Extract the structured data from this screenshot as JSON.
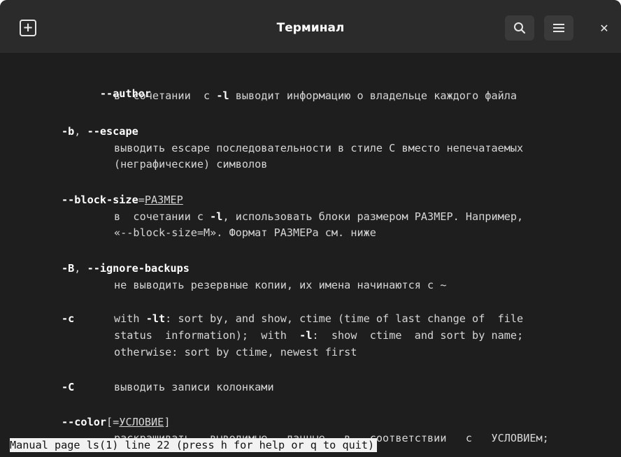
{
  "window": {
    "title": "Терминал"
  },
  "man": {
    "author_opt": "--author",
    "author_desc_a": "в  сочетании  с ",
    "author_desc_flag": "-l",
    "author_desc_b": " выводит информацию о владельце каждого файла",
    "escape_b": "-b",
    "escape_sep": ", ",
    "escape_opt": "--escape",
    "escape_desc1": "выводить escape последовательности в стиле C вместо непечатаемых",
    "escape_desc2": "(неграфические) символов",
    "bs_opt": "--block-size",
    "bs_eq": "=",
    "bs_arg": "РАЗМЕР",
    "bs_desc1_a": "в  сочетании с ",
    "bs_desc1_flag": "-l",
    "bs_desc1_b": ", использовать блоки размером РАЗМЕР. Например,",
    "bs_desc2": "«--block-size=M». Формат РАЗМЕРа см. ниже",
    "ib_B": "-B",
    "ib_sep": ", ",
    "ib_opt": "--ignore-backups",
    "ib_desc": "не выводить резервные копии, их имена начинаются с ~",
    "c_opt": "-c",
    "c_desc1_a": "with ",
    "c_desc1_flag": "-lt",
    "c_desc1_b": ": sort by, and show, ctime (time of last change of  file",
    "c_desc2_a": "status  information);  with  ",
    "c_desc2_flag": "-l",
    "c_desc2_b": ":  show  ctime  and sort by name;",
    "c_desc3": "otherwise: sort by ctime, newest first",
    "C_opt": "-C",
    "C_desc": "выводить записи колонками",
    "color_opt": "--color",
    "color_open": "[=",
    "color_arg": "УСЛОВИЕ",
    "color_close": "]",
    "color_desc": "раскрашивать   выводимые   данные   в   соответствии   с   УСЛОВИЕм;"
  },
  "status": {
    "prefix": "Manual page ls(1) line 22 (press h for help or q to quit)",
    "text": "Manual page ls(1) line 22 (press h for help or q to quit)"
  },
  "icons": {
    "new_tab": "new-tab-icon",
    "search": "search-icon",
    "menu": "hamburger-menu-icon",
    "close": "close-icon"
  },
  "colors": {
    "background": "#1e1e1e",
    "titlebar": "#2b2b2b",
    "text": "#d6d6d6",
    "status_bg": "#f2f2f2"
  }
}
